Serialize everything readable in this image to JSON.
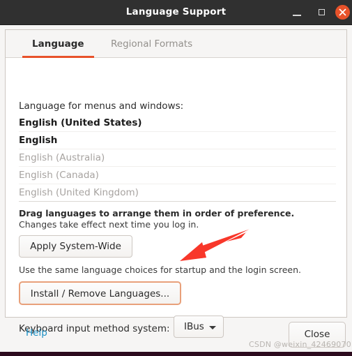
{
  "window": {
    "title": "Language Support",
    "controls": {
      "minimize": "minimize-button",
      "maximize": "maximize-button",
      "close": "close-button"
    }
  },
  "tabs": [
    {
      "label": "Language",
      "selected": true
    },
    {
      "label": "Regional Formats",
      "selected": false
    }
  ],
  "main": {
    "list_label": "Language for menus and windows:",
    "languages": [
      {
        "name": "English (United States)",
        "state": "active"
      },
      {
        "name": "English",
        "state": "active"
      },
      {
        "name": "English (Australia)",
        "state": "dim"
      },
      {
        "name": "English (Canada)",
        "state": "dim"
      },
      {
        "name": "English (United Kingdom)",
        "state": "dim"
      }
    ],
    "drag_hint": "Drag languages to arrange them in order of preference.",
    "change_hint": "Changes take effect next time you log in.",
    "apply_system_wide_label": "Apply System-Wide",
    "same_choices_hint": "Use the same language choices for startup and the login screen.",
    "install_remove_label": "Install / Remove Languages...",
    "keyboard_label": "Keyboard input method system:",
    "keyboard_value": "IBus"
  },
  "actions": {
    "help_label": "Help",
    "close_label": "Close"
  },
  "watermark": "CSDN @weixin_42469070",
  "colors": {
    "titlebar": "#303030",
    "accent": "#e8522a",
    "close_button": "#e8522a",
    "link": "#1a8fc4",
    "highlight_border": "#e8a07a",
    "arrow": "#f8372a",
    "bottom_strip": "#2c0b1e"
  }
}
